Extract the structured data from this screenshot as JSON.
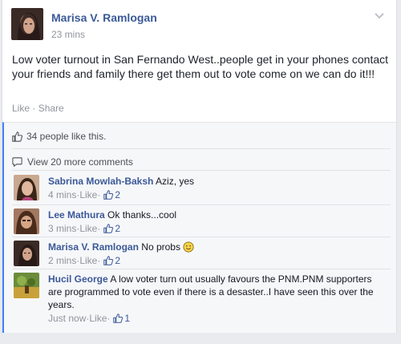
{
  "post": {
    "author": "Marisa V. Ramlogan",
    "time": "23 mins",
    "text": "Low voter turnout in San Fernando West..people get in your phones contact your friends and family there get them out to vote come on we can do it!!!",
    "actions": {
      "like": "Like",
      "sep": " · ",
      "share": "Share"
    }
  },
  "feedback": {
    "likes_text": "34 people like this.",
    "view_more": "View 20 more comments"
  },
  "comments": [
    {
      "name": "Sabrina Mowlah-Baksh",
      "text": " Aziz, yes",
      "time": "4 mins",
      "like": "Like",
      "likes": "2"
    },
    {
      "name": "Lee Mathura",
      "text": " Ok thanks...cool",
      "time": "3 mins",
      "like": "Like",
      "likes": "2"
    },
    {
      "name": "Marisa V. Ramlogan",
      "text": " No probs ",
      "time": "2 mins",
      "like": "Like",
      "likes": "2"
    },
    {
      "name": "Hucil George",
      "text": " A low voter turn out usually favours the PNM.PNM supporters are programmed to vote even if there is a desaster..I have seen this over the years.",
      "time": "Just now",
      "like": "Like",
      "likes": "1"
    }
  ],
  "meta_sep": " · ",
  "colors": {
    "link": "#3b5998",
    "muted": "#90949c",
    "accent": "#4080ff"
  }
}
